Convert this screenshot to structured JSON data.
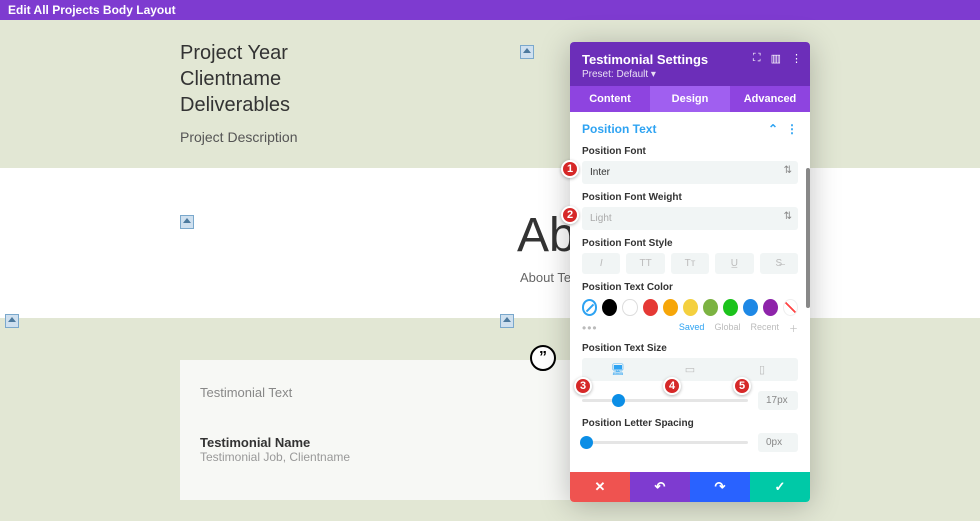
{
  "topbar": {
    "title": "Edit All Projects Body Layout"
  },
  "project": {
    "year": "Project Year",
    "client": "Clientname",
    "deliverables": "Deliverables",
    "description": "Project Description"
  },
  "about": {
    "heading": "About",
    "text": "About Text"
  },
  "testimonial": {
    "text": "Testimonial Text",
    "name": "Testimonial Name",
    "job": "Testimonial Job, ",
    "company": "Clientname"
  },
  "panel": {
    "title": "Testimonial Settings",
    "preset_label": "Preset: ",
    "preset_value": "Default ▾",
    "tabs": {
      "content": "Content",
      "design": "Design",
      "advanced": "Advanced"
    },
    "section": "Position Text",
    "fields": {
      "font_label": "Position Font",
      "font_value": "Inter",
      "weight_label": "Position Font Weight",
      "weight_value": "Light",
      "style_label": "Position Font Style",
      "style_buttons": {
        "italic": "I",
        "uppercase": "TT",
        "smallcaps": "Tᴛ",
        "underline": "U̲",
        "strike": "S̶"
      },
      "color_label": "Position Text Color",
      "swatch_links": {
        "saved": "Saved",
        "global": "Global",
        "recent": "Recent"
      },
      "size_label": "Position Text Size",
      "size_value": "17px",
      "spacing_label": "Position Letter Spacing",
      "spacing_value": "0px"
    },
    "colors": {
      "black": "#000000",
      "white": "#ffffff",
      "red": "#e53935",
      "orange": "#f6a609",
      "yellow": "#f4d03f",
      "lime": "#7cb342",
      "green": "#1cc31c",
      "blue": "#1e88e5",
      "purple": "#8e24aa"
    },
    "footer_icons": {
      "close": "✕",
      "undo": "↶",
      "redo": "↷",
      "check": "✓"
    }
  },
  "badges": {
    "b1": "1",
    "b2": "2",
    "b3": "3",
    "b4": "4",
    "b5": "5"
  }
}
